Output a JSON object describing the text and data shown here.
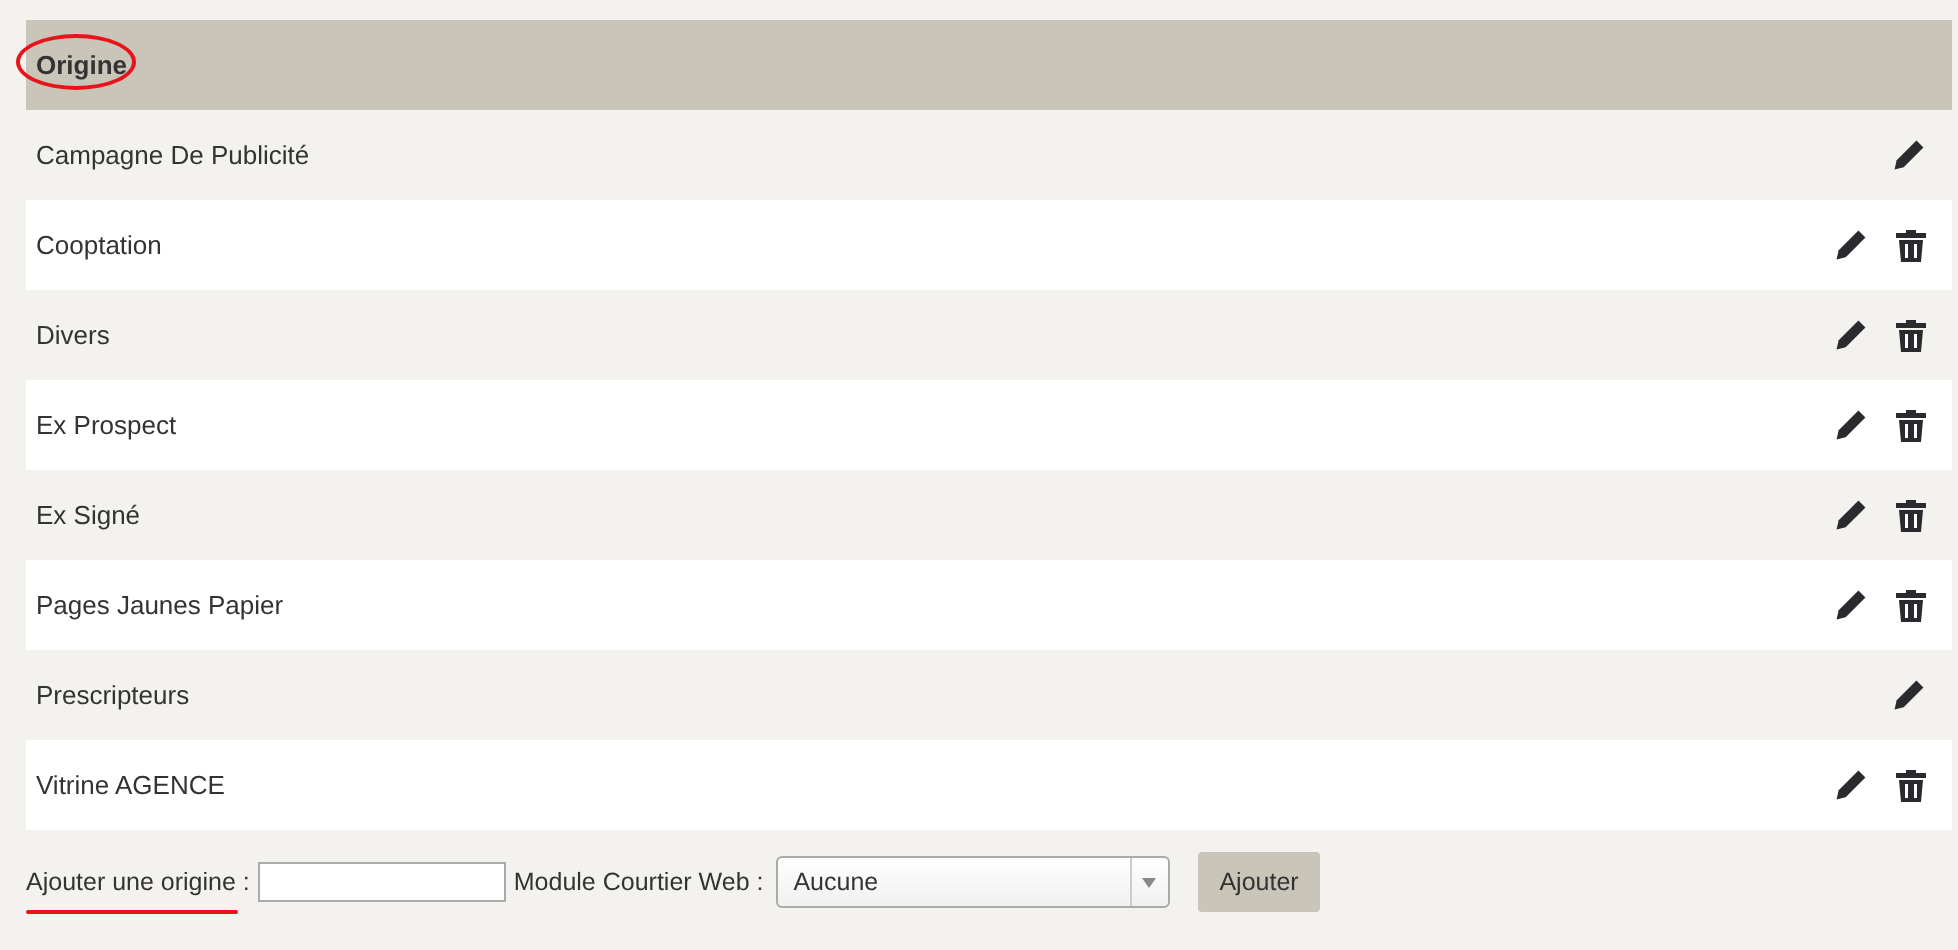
{
  "table": {
    "header": "Origine",
    "header_circled": true,
    "rows": [
      {
        "label": "Campagne De Publicité",
        "deletable": false
      },
      {
        "label": "Cooptation",
        "deletable": true
      },
      {
        "label": "Divers",
        "deletable": true
      },
      {
        "label": "Ex Prospect",
        "deletable": true
      },
      {
        "label": "Ex Signé",
        "deletable": true
      },
      {
        "label": "Pages Jaunes Papier",
        "deletable": true
      },
      {
        "label": "Prescripteurs",
        "deletable": false
      },
      {
        "label": "Vitrine AGENCE",
        "deletable": true
      }
    ]
  },
  "add_form": {
    "label": "Ajouter une origine :",
    "label_underlined": true,
    "module_label": "Module Courtier Web :",
    "module_value": "Aucune",
    "button": "Ajouter"
  }
}
